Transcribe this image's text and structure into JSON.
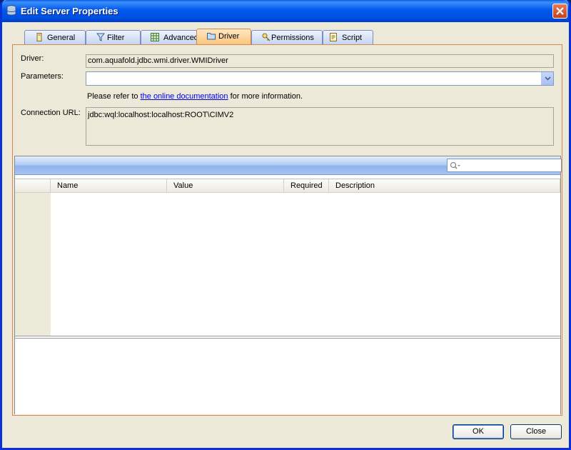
{
  "window": {
    "title": "Edit Server Properties"
  },
  "tabs": [
    {
      "label": "General",
      "icon": "server-icon"
    },
    {
      "label": "Filter",
      "icon": "filter-icon"
    },
    {
      "label": "Advanced",
      "icon": "grid-icon"
    },
    {
      "label": "Driver",
      "icon": "folder-icon",
      "active": true
    },
    {
      "label": "Permissions",
      "icon": "key-icon"
    },
    {
      "label": "Script",
      "icon": "script-icon"
    }
  ],
  "driver": {
    "driver_label": "Driver:",
    "driver_value": "com.aquafold.jdbc.wmi.driver.WMIDriver",
    "parameters_label": "Parameters:",
    "parameters_value": "",
    "info_prefix": "Please refer to ",
    "info_link": "the online documentation",
    "info_suffix": " for more information.",
    "url_label": "Connection URL:",
    "url_value": "jdbc:wql:localhost:localhost:ROOT\\CIMV2"
  },
  "properties_table": {
    "columns": [
      "Name",
      "Value",
      "Required",
      "Description"
    ],
    "rows": []
  },
  "search": {
    "value": ""
  },
  "buttons": {
    "ok": "OK",
    "close": "Close"
  },
  "colors": {
    "titlebar": "#0058ee",
    "active_tab": "#fbc27a",
    "panel_border": "#d08a55",
    "link": "#0000ee"
  }
}
